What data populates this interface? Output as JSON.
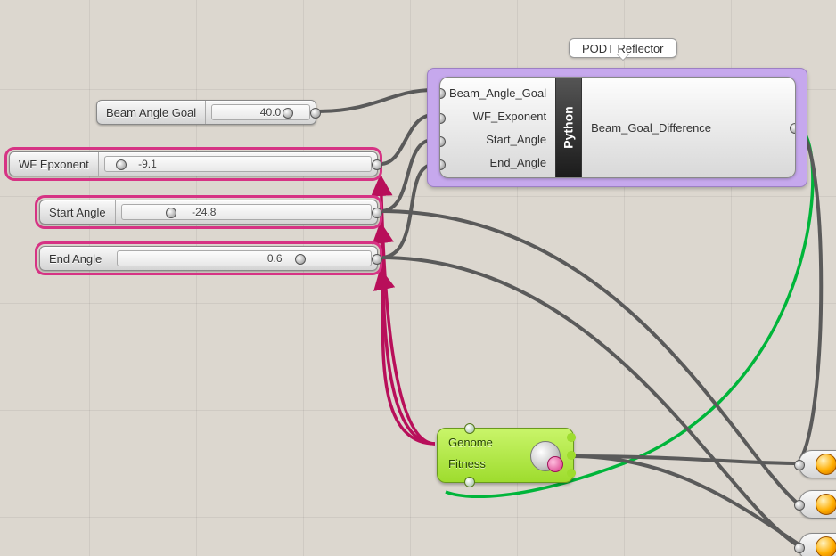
{
  "sliders": {
    "beam_angle_goal": {
      "label": "Beam Angle Goal",
      "value": "40.0",
      "selected": false
    },
    "wf_exponent": {
      "label": "WF Epxonent",
      "value": "-9.1",
      "selected": true
    },
    "start_angle": {
      "label": "Start Angle",
      "value": "-24.8",
      "selected": true
    },
    "end_angle": {
      "label": "End Angle",
      "value": "0.6",
      "selected": true
    }
  },
  "group": {
    "title": "PODT Reflector"
  },
  "python": {
    "name": "Python",
    "inputs": [
      "Beam_Angle_Goal",
      "WF_Exponent",
      "Start_Angle",
      "End_Angle"
    ],
    "output": "Beam_Goal_Difference"
  },
  "galapagos": {
    "genome_label": "Genome",
    "fitness_label": "Fitness"
  },
  "params": {
    "count": 3,
    "icon_name": "data-orb-icon"
  },
  "wire_colors": {
    "normal": "#5a5a5a",
    "selected": "#b80f5a",
    "fitness": "#00b53a"
  }
}
